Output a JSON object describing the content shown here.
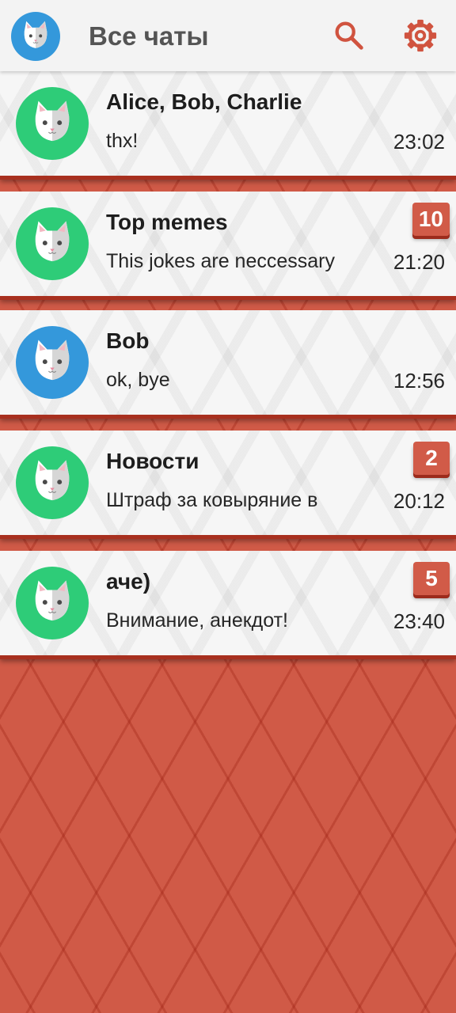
{
  "header": {
    "title": "Все чаты",
    "avatar_icon": "cat-avatar-icon",
    "search_icon": "search-icon",
    "settings_icon": "gear-icon"
  },
  "colors": {
    "accent": "#d15b48",
    "accent_dark": "#a8301f",
    "avatar_green": "#2ecc78",
    "avatar_blue": "#3498db",
    "header_bg": "#f3f3f3"
  },
  "chats": [
    {
      "name": "Alice, Bob, Charlie",
      "preview": "thx!",
      "time": "23:02",
      "unread": "",
      "avatar_color": "green"
    },
    {
      "name": "Top memes",
      "preview": "This jokes are neccessary",
      "time": "21:20",
      "unread": "10",
      "avatar_color": "green"
    },
    {
      "name": "Bob",
      "preview": "ok, bye",
      "time": "12:56",
      "unread": "",
      "avatar_color": "blue"
    },
    {
      "name": "Новости",
      "preview": "Штраф за ковыряние в",
      "time": "20:12",
      "unread": "2",
      "avatar_color": "green"
    },
    {
      "name": "аче)",
      "preview": "Внимание, анекдот!",
      "time": "23:40",
      "unread": "5",
      "avatar_color": "green"
    }
  ]
}
